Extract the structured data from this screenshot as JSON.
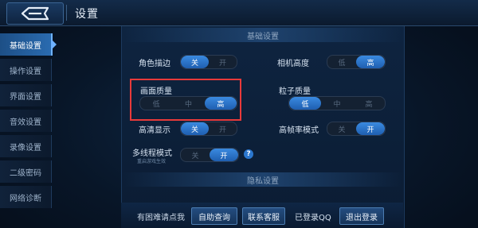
{
  "header": {
    "title": "设置",
    "back_icon": "back-arrow-icon"
  },
  "sidebar": {
    "items": [
      {
        "label": "基础设置",
        "active": true
      },
      {
        "label": "操作设置",
        "active": false
      },
      {
        "label": "界面设置",
        "active": false
      },
      {
        "label": "音效设置",
        "active": false
      },
      {
        "label": "录像设置",
        "active": false
      },
      {
        "label": "二级密码",
        "active": false
      },
      {
        "label": "网络诊断",
        "active": false
      }
    ]
  },
  "basic": {
    "section_title": "基础设置",
    "outline": {
      "label": "角色描边",
      "options": [
        "关",
        "开"
      ],
      "selected": "关"
    },
    "camera_height": {
      "label": "相机高度",
      "options": [
        "低",
        "高"
      ],
      "selected": "高"
    },
    "quality": {
      "label": "画面质量",
      "options": [
        "低",
        "中",
        "高"
      ],
      "selected": "高"
    },
    "particle": {
      "label": "粒子质量",
      "options": [
        "低",
        "中",
        "高"
      ],
      "selected": "低"
    },
    "hd": {
      "label": "高清显示",
      "options": [
        "关",
        "开"
      ],
      "selected": "关"
    },
    "high_fps": {
      "label": "高帧率模式",
      "options": [
        "关",
        "开"
      ],
      "selected": "开"
    },
    "multithread": {
      "label": "多线程模式",
      "sublabel": "重启游戏生效",
      "options": [
        "关",
        "开"
      ],
      "selected": "开",
      "help": "?"
    }
  },
  "privacy": {
    "section_title": "隐私设置"
  },
  "footer": {
    "help_text": "有困难请点我",
    "self_service_btn": "自助查询",
    "contact_btn": "联系客服",
    "login_status": "已登录QQ",
    "logout_btn": "退出登录"
  },
  "colors": {
    "accent": "#2f7ad4",
    "highlight_box": "#e83a3a"
  }
}
